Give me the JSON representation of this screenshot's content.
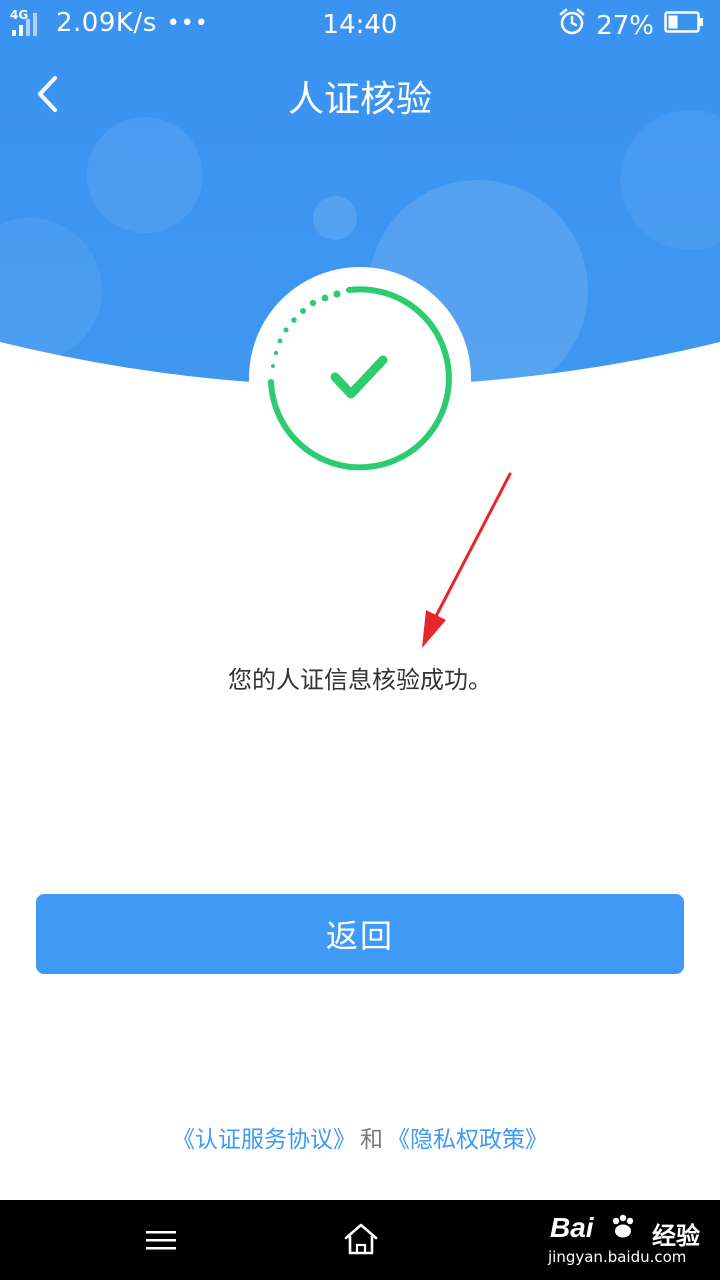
{
  "status_bar": {
    "network_type": "4G",
    "speed": "2.09K/s",
    "more": "•••",
    "time": "14:40",
    "battery_percent": "27%"
  },
  "header": {
    "title": "人证核验",
    "back_icon": "chevron-left-icon"
  },
  "result": {
    "icon": "check-circle-icon",
    "message": "您的人证信息核验成功。"
  },
  "actions": {
    "return_label": "返回"
  },
  "footer": {
    "agreement_link": "《认证服务协议》",
    "connector": "和",
    "privacy_link": "《隐私权政策》"
  },
  "nav_bar": {
    "menu_icon": "menu-icon",
    "home_icon": "home-icon"
  },
  "watermark": {
    "brand": "Bai",
    "text": "经验",
    "url": "jingyan.baidu.com"
  },
  "colors": {
    "header_blue": "#3d95f0",
    "accent": "#3e9af5",
    "success_green": "#2ecc71",
    "annotation_red": "#e8262a"
  }
}
